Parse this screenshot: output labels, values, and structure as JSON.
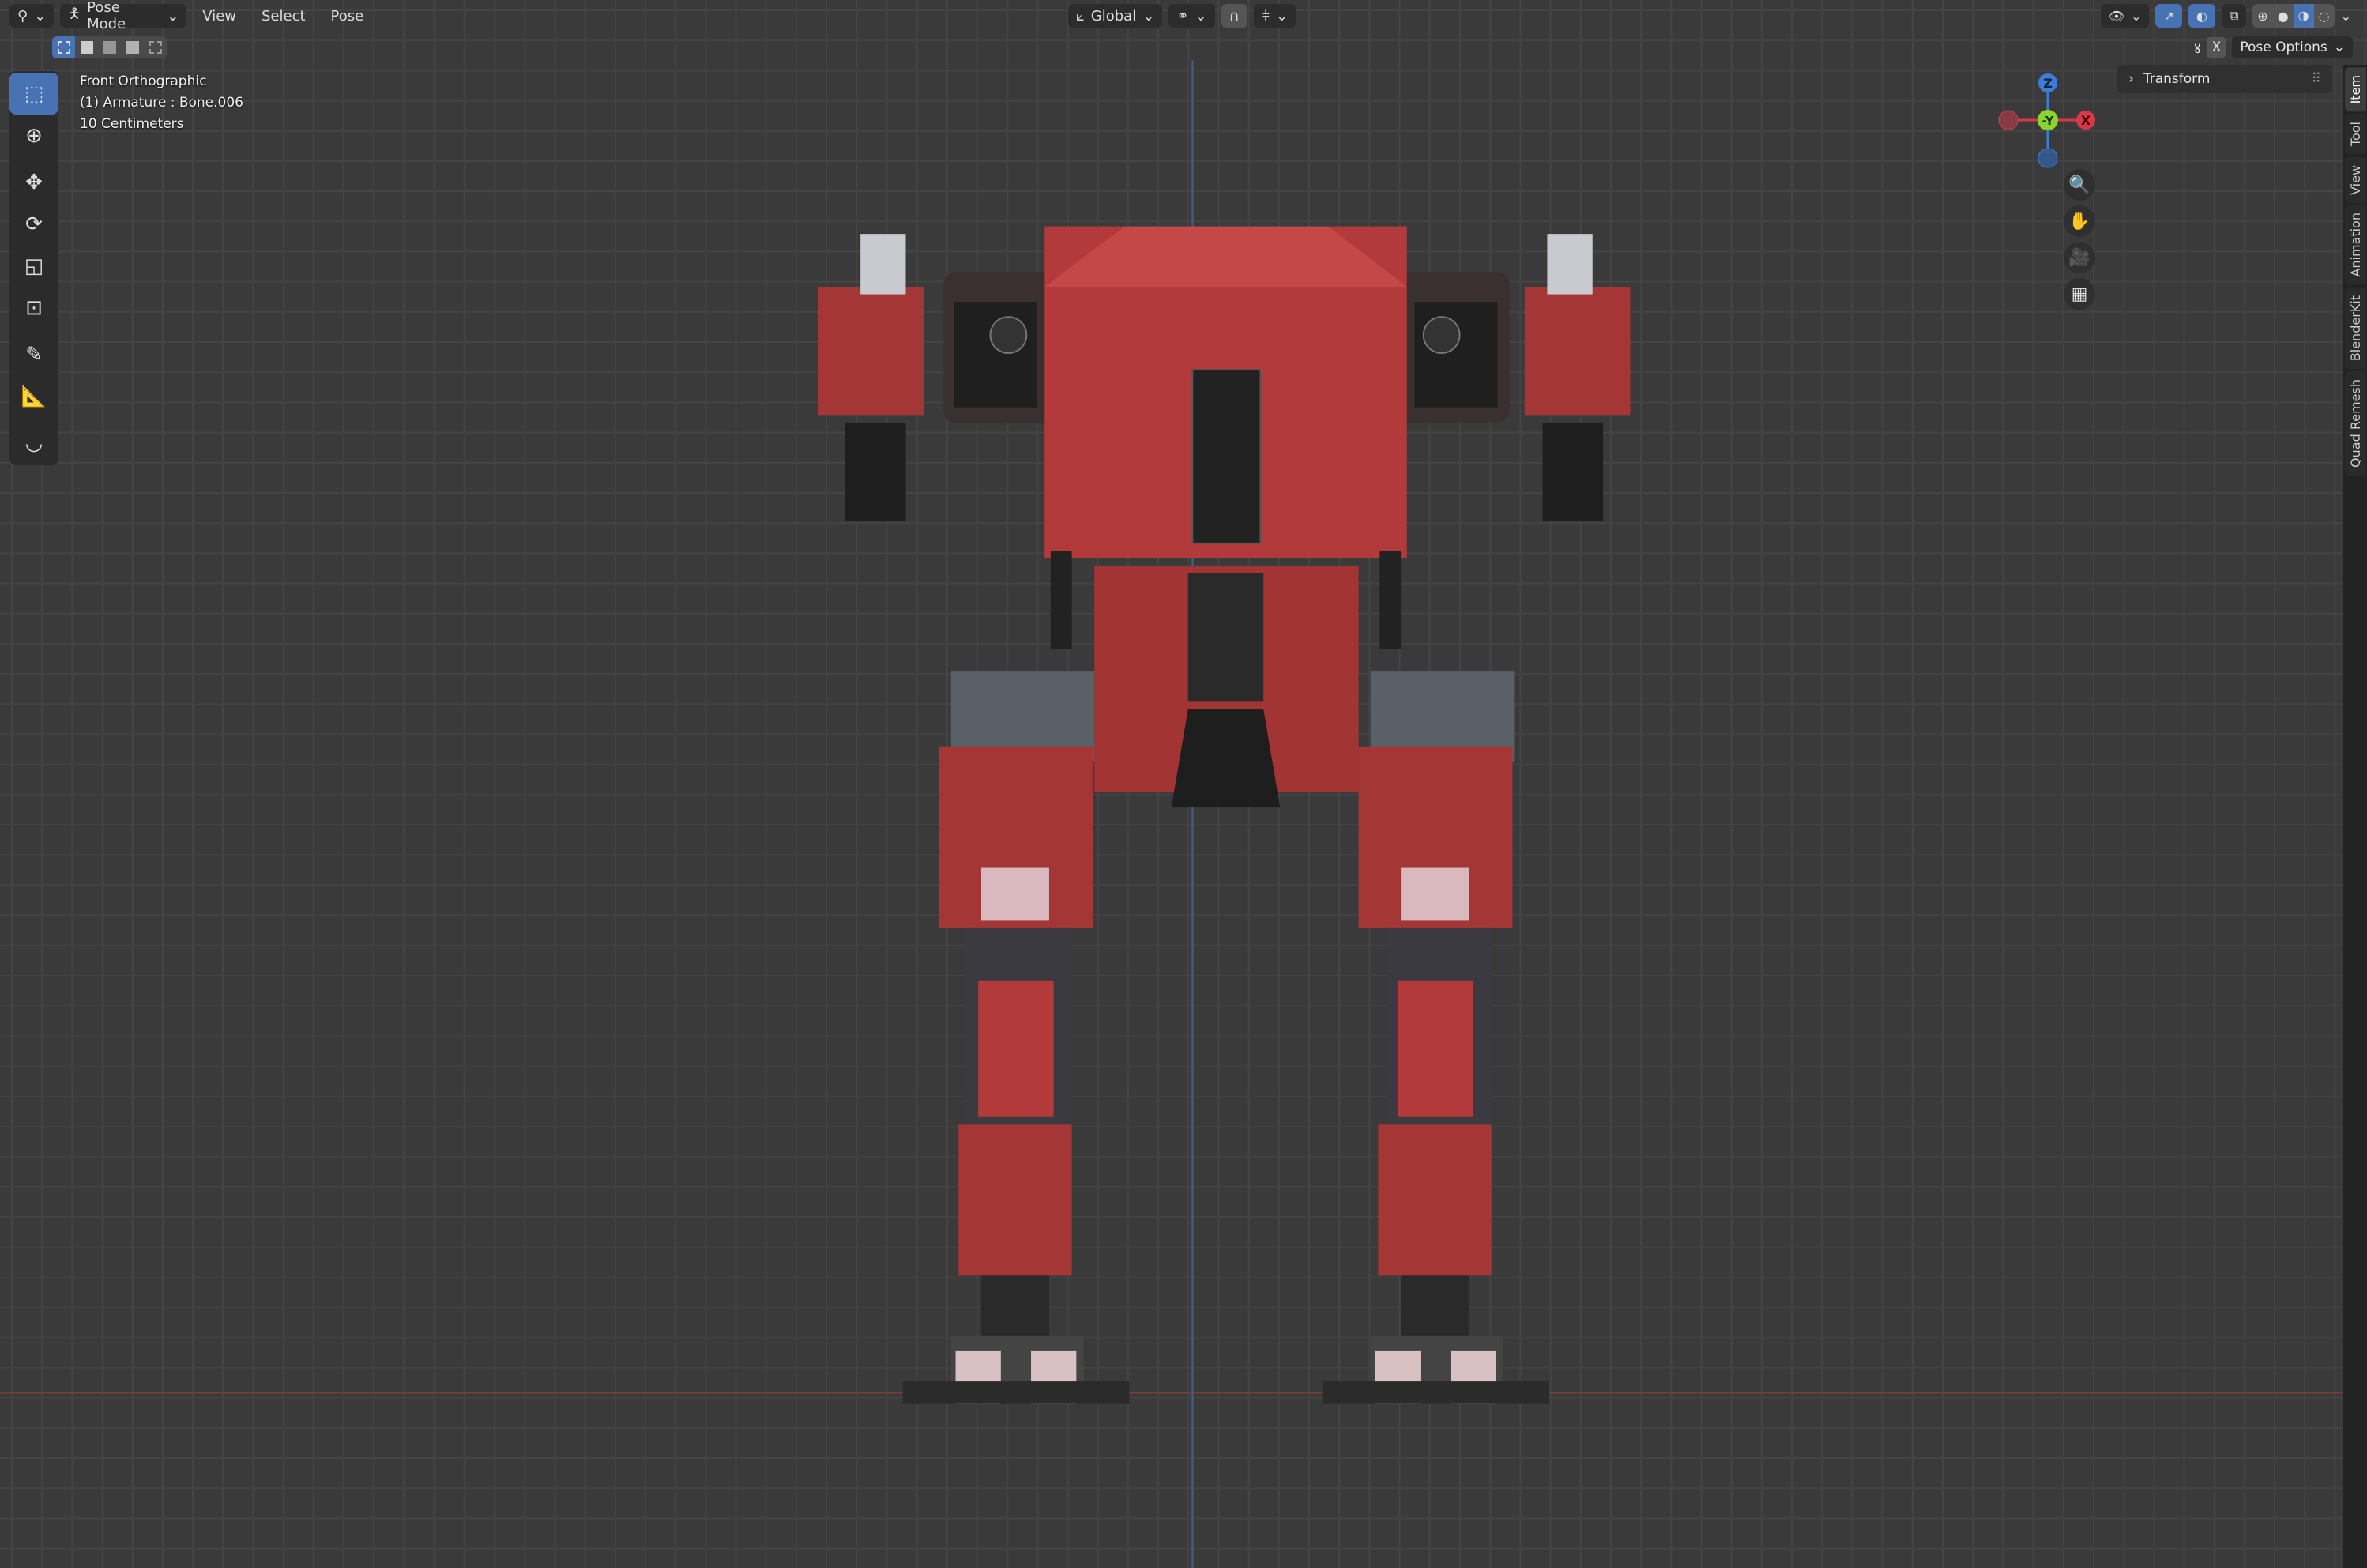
{
  "header": {
    "editor_type_icon": "armature-icon",
    "mode": "Pose Mode",
    "menus": [
      "View",
      "Select",
      "Pose"
    ],
    "transform_orientation": "Global"
  },
  "select_modes": [
    "select-new-icon",
    "select-extend-icon",
    "select-subtract-icon",
    "select-invert-icon",
    "select-intersect-icon"
  ],
  "tools": [
    "select-box",
    "cursor",
    "move",
    "rotate",
    "scale",
    "transform",
    "annotate",
    "measure",
    "bone-envelope"
  ],
  "viewport_info": {
    "view": "Front Orthographic",
    "object": "(1) Armature : Bone.006",
    "scale": "10 Centimeters"
  },
  "pose_options": {
    "mirror_axis": "X",
    "label": "Pose Options"
  },
  "npanel": {
    "section": "Transform",
    "tabs": [
      "Item",
      "Tool",
      "View",
      "Animation",
      "BlenderKit",
      "Quad Remesh"
    ]
  },
  "gizmo": {
    "z": "Z",
    "y": "-Y",
    "x": "X"
  },
  "colors": {
    "accent": "#4772b3",
    "x_axis": "#d9384a",
    "y_axis": "#8bd42d",
    "z_axis": "#3b7dd8",
    "robot_red": "#b23a3a"
  }
}
